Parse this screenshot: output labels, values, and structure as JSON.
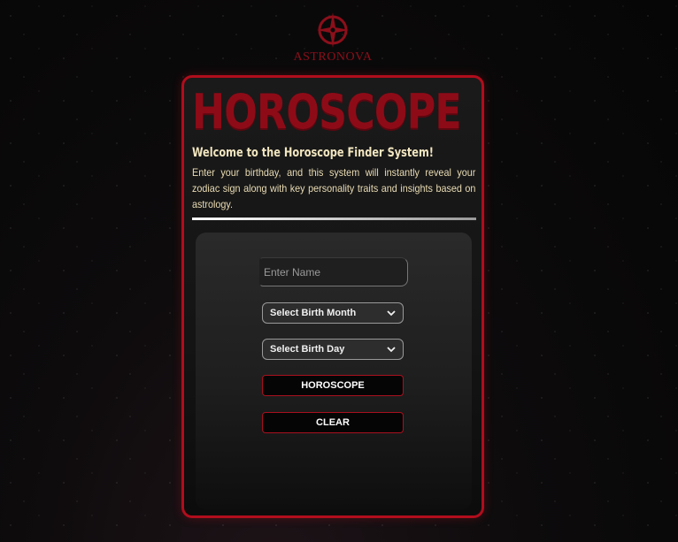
{
  "brand": {
    "name": "ASTRONOVA",
    "logo_icon": "compass-star-icon",
    "accent_color": "#b10d1c"
  },
  "header": {
    "title": "HOROSCOPE",
    "welcome": "Welcome to the Horoscope Finder System!",
    "description": "Enter your birthday, and this system will instantly reveal your zodiac sign along with key personality traits and insights based on astrology."
  },
  "form": {
    "name_placeholder": "Enter Name",
    "month_select": "Select Birth Month",
    "day_select": "Select Birth Day",
    "horoscope_button": "HOROSCOPE",
    "clear_button": "CLEAR"
  }
}
